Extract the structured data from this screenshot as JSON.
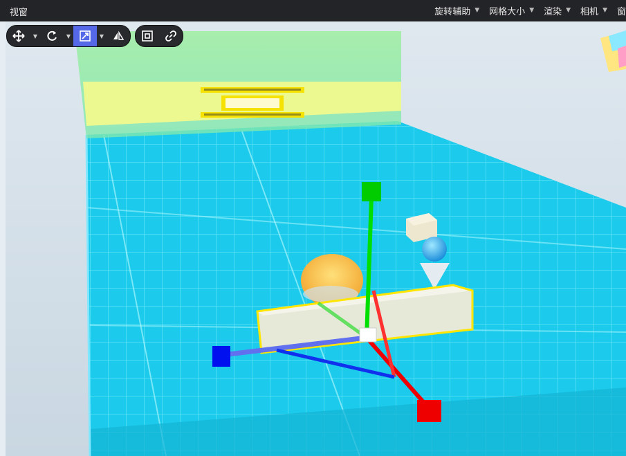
{
  "window": {
    "title": "视窗"
  },
  "menus": [
    {
      "label": "旋转辅助"
    },
    {
      "label": "网格大小"
    },
    {
      "label": "渲染"
    },
    {
      "label": "相机"
    },
    {
      "label": "窗"
    }
  ],
  "toolbar": {
    "move_tool": "move-icon",
    "rotate_tool": "rotate-icon",
    "scale_tool": "scale-icon",
    "pivot_tool": "pivot-icon",
    "local_space": "local-space-icon",
    "snap_link": "link-icon",
    "active_tool": "scale"
  },
  "colors": {
    "axis_x": "#ff0000",
    "axis_y": "#00ee00",
    "axis_z": "#0010ee",
    "selection": "#ffe600",
    "active_tool": "#5468e8",
    "floor": "#1fd0f0",
    "wall": "#a8f0a0"
  }
}
